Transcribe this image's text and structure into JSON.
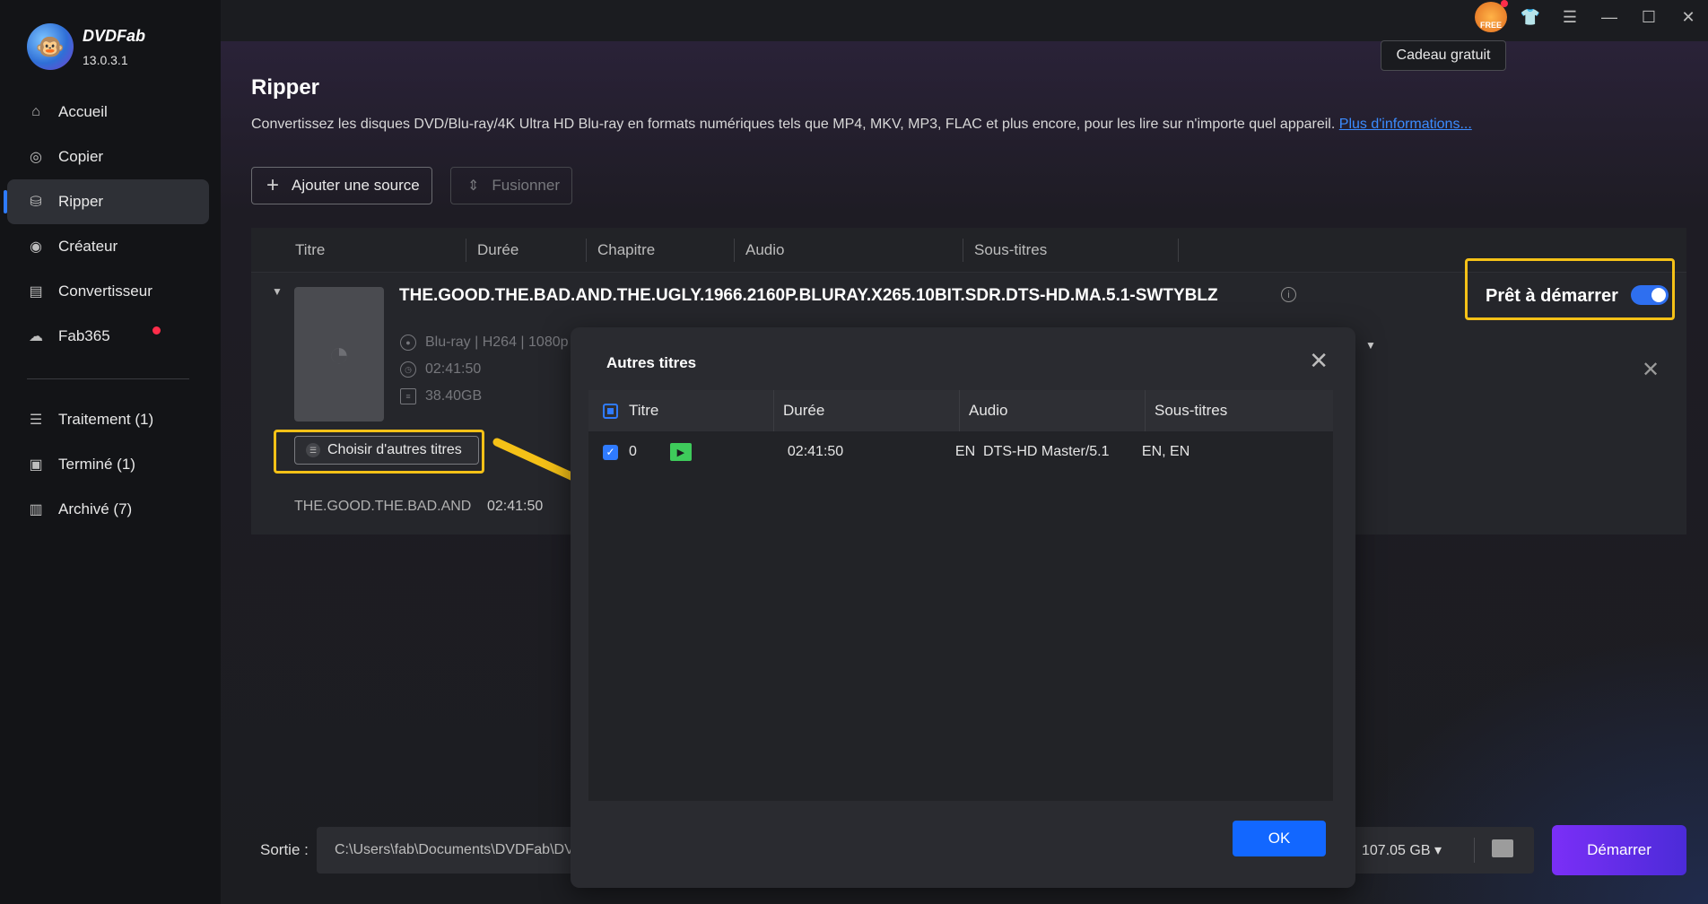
{
  "app": {
    "name": "DVDFab",
    "version": "13.0.3.1"
  },
  "titlebar": {
    "free_label": "FREE",
    "tooltip": "Cadeau gratuit"
  },
  "sidebar": {
    "items": [
      {
        "label": "Accueil",
        "icon": "home-icon"
      },
      {
        "label": "Copier",
        "icon": "copy-icon"
      },
      {
        "label": "Ripper",
        "icon": "ripper-icon",
        "active": true
      },
      {
        "label": "Créateur",
        "icon": "creator-icon"
      },
      {
        "label": "Convertisseur",
        "icon": "converter-icon"
      },
      {
        "label": "Fab365",
        "icon": "fab365-icon",
        "badge": "red-dot"
      }
    ],
    "queue": [
      {
        "label": "Traitement (1)",
        "icon": "processing-icon"
      },
      {
        "label": "Terminé (1)",
        "icon": "done-icon"
      },
      {
        "label": "Archivé (7)",
        "icon": "archive-icon"
      }
    ]
  },
  "page": {
    "title": "Ripper",
    "description": "Convertissez les disques DVD/Blu-ray/4K Ultra HD Blu-ray en formats numériques tels que MP4, MKV, MP3, FLAC et plus encore, pour les lire sur n'importe quel appareil.",
    "more_link": "Plus d'informations...",
    "add_source": "Ajouter une source",
    "merge": "Fusionner"
  },
  "list": {
    "columns": [
      "Titre",
      "Durée",
      "Chapitre",
      "Audio",
      "Sous-titres"
    ],
    "movie": {
      "title": "THE.GOOD.THE.BAD.AND.THE.UGLY.1966.2160P.BLURAY.X265.10BIT.SDR.DTS-HD.MA.5.1-SWTYBLZ",
      "format": "Blu-ray | H264 | 1080p",
      "duration": "02:41:50",
      "size": "38.40GB",
      "choose_titles": "Choisir d'autres titres",
      "row_title": "THE.GOOD.THE.BAD.AND",
      "row_duration": "02:41:50"
    },
    "ready_label": "Prêt à démarrer",
    "ready_on": true
  },
  "dialog": {
    "title": "Autres titres",
    "columns": [
      "Titre",
      "Durée",
      "Audio",
      "Sous-titres"
    ],
    "rows": [
      {
        "index": "0",
        "checked": true,
        "duration": "02:41:50",
        "audio_lang": "EN",
        "audio_codec": "DTS-HD Master/5.1",
        "subtitles": "EN, EN"
      }
    ],
    "ok": "OK"
  },
  "output": {
    "label": "Sortie :",
    "path": "C:\\Users\\fab\\Documents\\DVDFab\\DVDFab13",
    "size": "107.05 GB",
    "start": "Démarrer"
  },
  "colors": {
    "accent": "#2f7bff",
    "highlight": "#f5c117",
    "start": "#7b2ff7"
  }
}
